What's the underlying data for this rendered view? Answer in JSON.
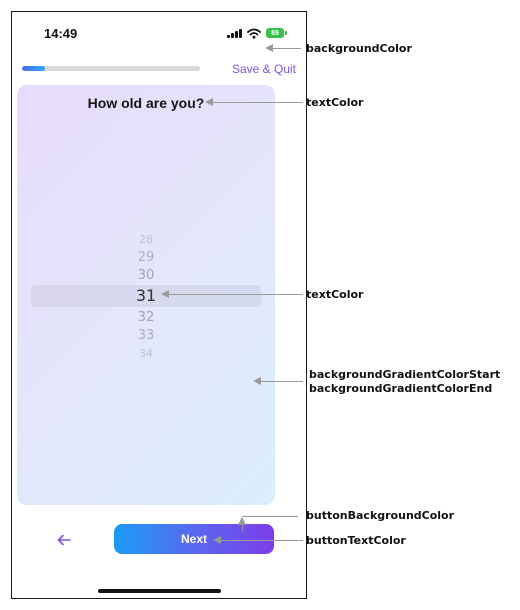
{
  "status_bar": {
    "time": "14:49",
    "battery_level": "89"
  },
  "header": {
    "progress_percent": 13,
    "save_quit_label": "Save & Quit"
  },
  "card": {
    "question": "How old are you?",
    "picker": {
      "items": [
        "28",
        "29",
        "30",
        "31",
        "32",
        "33",
        "34"
      ],
      "selected": "31"
    }
  },
  "footer": {
    "next_label": "Next",
    "back_icon": "arrow-left-icon"
  },
  "annotations": {
    "background_color": "backgroundColor",
    "question_text_color": "textColor",
    "picker_text_color": "textColor",
    "gradient_start": "backgroundGradientColorStart",
    "gradient_end": "backgroundGradientColorEnd",
    "button_background": "buttonBackgroundColor",
    "button_text": "buttonTextColor"
  },
  "colors": {
    "accent": "#7b55e0",
    "progress_fill": "#3a8cf8",
    "card_gradient_start": "#e6dbfb",
    "card_gradient_end": "#daeefd",
    "button_gradient_start": "#1c9bf4",
    "button_gradient_end": "#7c3ee8",
    "battery": "#36c24a"
  }
}
